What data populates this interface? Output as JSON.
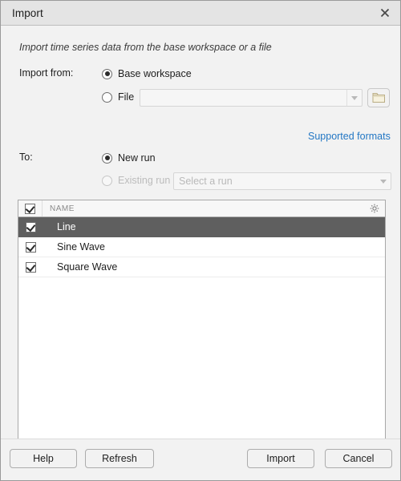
{
  "window": {
    "title": "Import",
    "close_icon": "close-icon"
  },
  "subtitle": "Import time series data from the base workspace or a file",
  "import_from": {
    "label": "Import from:",
    "options": [
      {
        "label": "Base workspace",
        "selected": true
      },
      {
        "label": "File",
        "selected": false
      }
    ],
    "file_combo": {
      "value": "",
      "placeholder": "",
      "arrow_icon": "chevron-down-icon",
      "enabled": false
    },
    "browse_button": {
      "icon": "folder-icon",
      "tooltip": "Browse"
    },
    "supported_formats_link": "Supported formats",
    "link_color": "#2377c4"
  },
  "to": {
    "label": "To:",
    "options": [
      {
        "label": "New run",
        "selected": true,
        "enabled": true
      },
      {
        "label": "Existing run",
        "selected": false,
        "enabled": false
      }
    ],
    "existing_run_combo": {
      "value": "",
      "placeholder": "Select a run",
      "arrow_icon": "chevron-down-icon",
      "enabled": false
    }
  },
  "table": {
    "header": {
      "select_all_checked": true,
      "columns": [
        "NAME"
      ],
      "settings_icon": "gear-icon"
    },
    "rows": [
      {
        "checked": true,
        "name": "Line",
        "selected": true
      },
      {
        "checked": true,
        "name": "Sine Wave",
        "selected": false
      },
      {
        "checked": true,
        "name": "Square Wave",
        "selected": false
      }
    ]
  },
  "footer": {
    "help_label": "Help",
    "refresh_label": "Refresh",
    "import_label": "Import",
    "cancel_label": "Cancel"
  },
  "colors": {
    "dialog_bg": "#f2f2f2",
    "titlebar_bg": "#e4e4e4",
    "table_bg": "#ffffff",
    "row_selected_bg": "#5f5f5f",
    "link": "#2377c4",
    "folder_icon": "#f5f0dc"
  }
}
